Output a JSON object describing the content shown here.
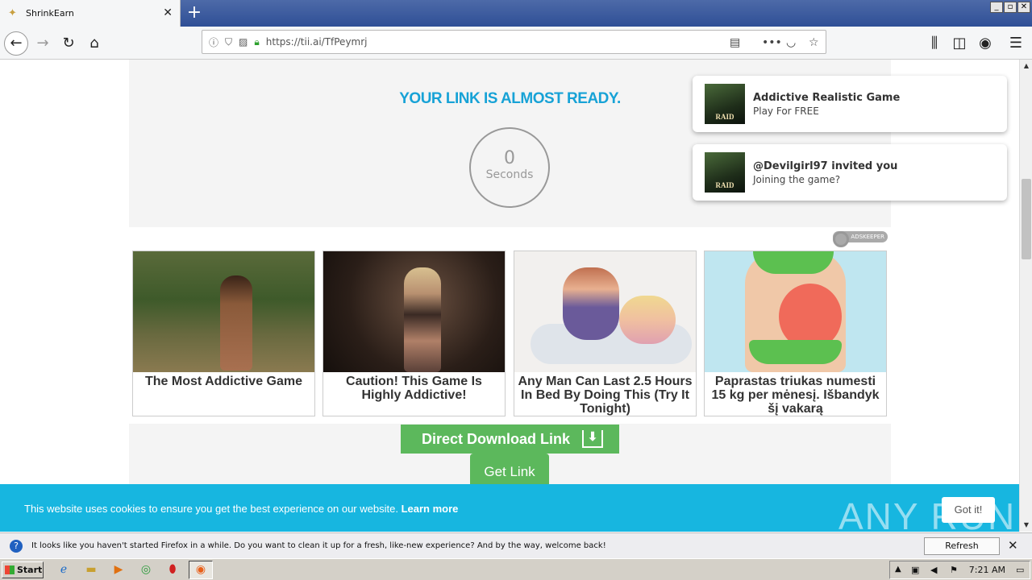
{
  "browser": {
    "tab_title": "ShrinkEarn",
    "url": "https://tii.ai/TfPeymrj",
    "new_tab_label": "+",
    "window_buttons": [
      "_",
      "▫",
      "✕"
    ]
  },
  "page": {
    "heading": "YOUR LINK IS ALMOST READY.",
    "timer_value": "0",
    "timer_unit": "Seconds",
    "ad_network_label": "ADSKEEPER",
    "ads": [
      {
        "caption": "The Most Addictive Game"
      },
      {
        "caption": "Caution! This Game Is Highly Addictive!"
      },
      {
        "caption": "Any Man Can Last 2.5 Hours In Bed By Doing This (Try It Tonight)"
      },
      {
        "caption": "Paprastas triukas numesti 15 kg per mėnesį. Išbandyk šį vakarą"
      }
    ],
    "direct_download_label": "Direct Download Link",
    "get_link_label": "Get Link"
  },
  "notifications": [
    {
      "title": "Addictive Realistic Game",
      "subtitle": "Play For FREE",
      "thumb_text": "RAID"
    },
    {
      "title": "@Devilgirl97 invited you",
      "subtitle": "Joining the game?",
      "thumb_text": "RAID"
    }
  ],
  "cookie_bar": {
    "message": "This website uses cookies to ensure you get the best experience on our website.",
    "learn_more": "Learn more",
    "button": "Got it!",
    "watermark": "ANY RUN"
  },
  "firefox_notice": {
    "message": "It looks like you haven't started Firefox in a while. Do you want to clean it up for a fresh, like-new experience? And by the way, welcome back!",
    "button": "Refresh Firefox…"
  },
  "taskbar": {
    "start_label": "Start",
    "clock": "7:21 AM"
  },
  "colors": {
    "heading": "#17a2d6",
    "button_green": "#5cb85c",
    "cookie_bar": "#17b6e0",
    "tabstrip": "#3a5a9e"
  }
}
